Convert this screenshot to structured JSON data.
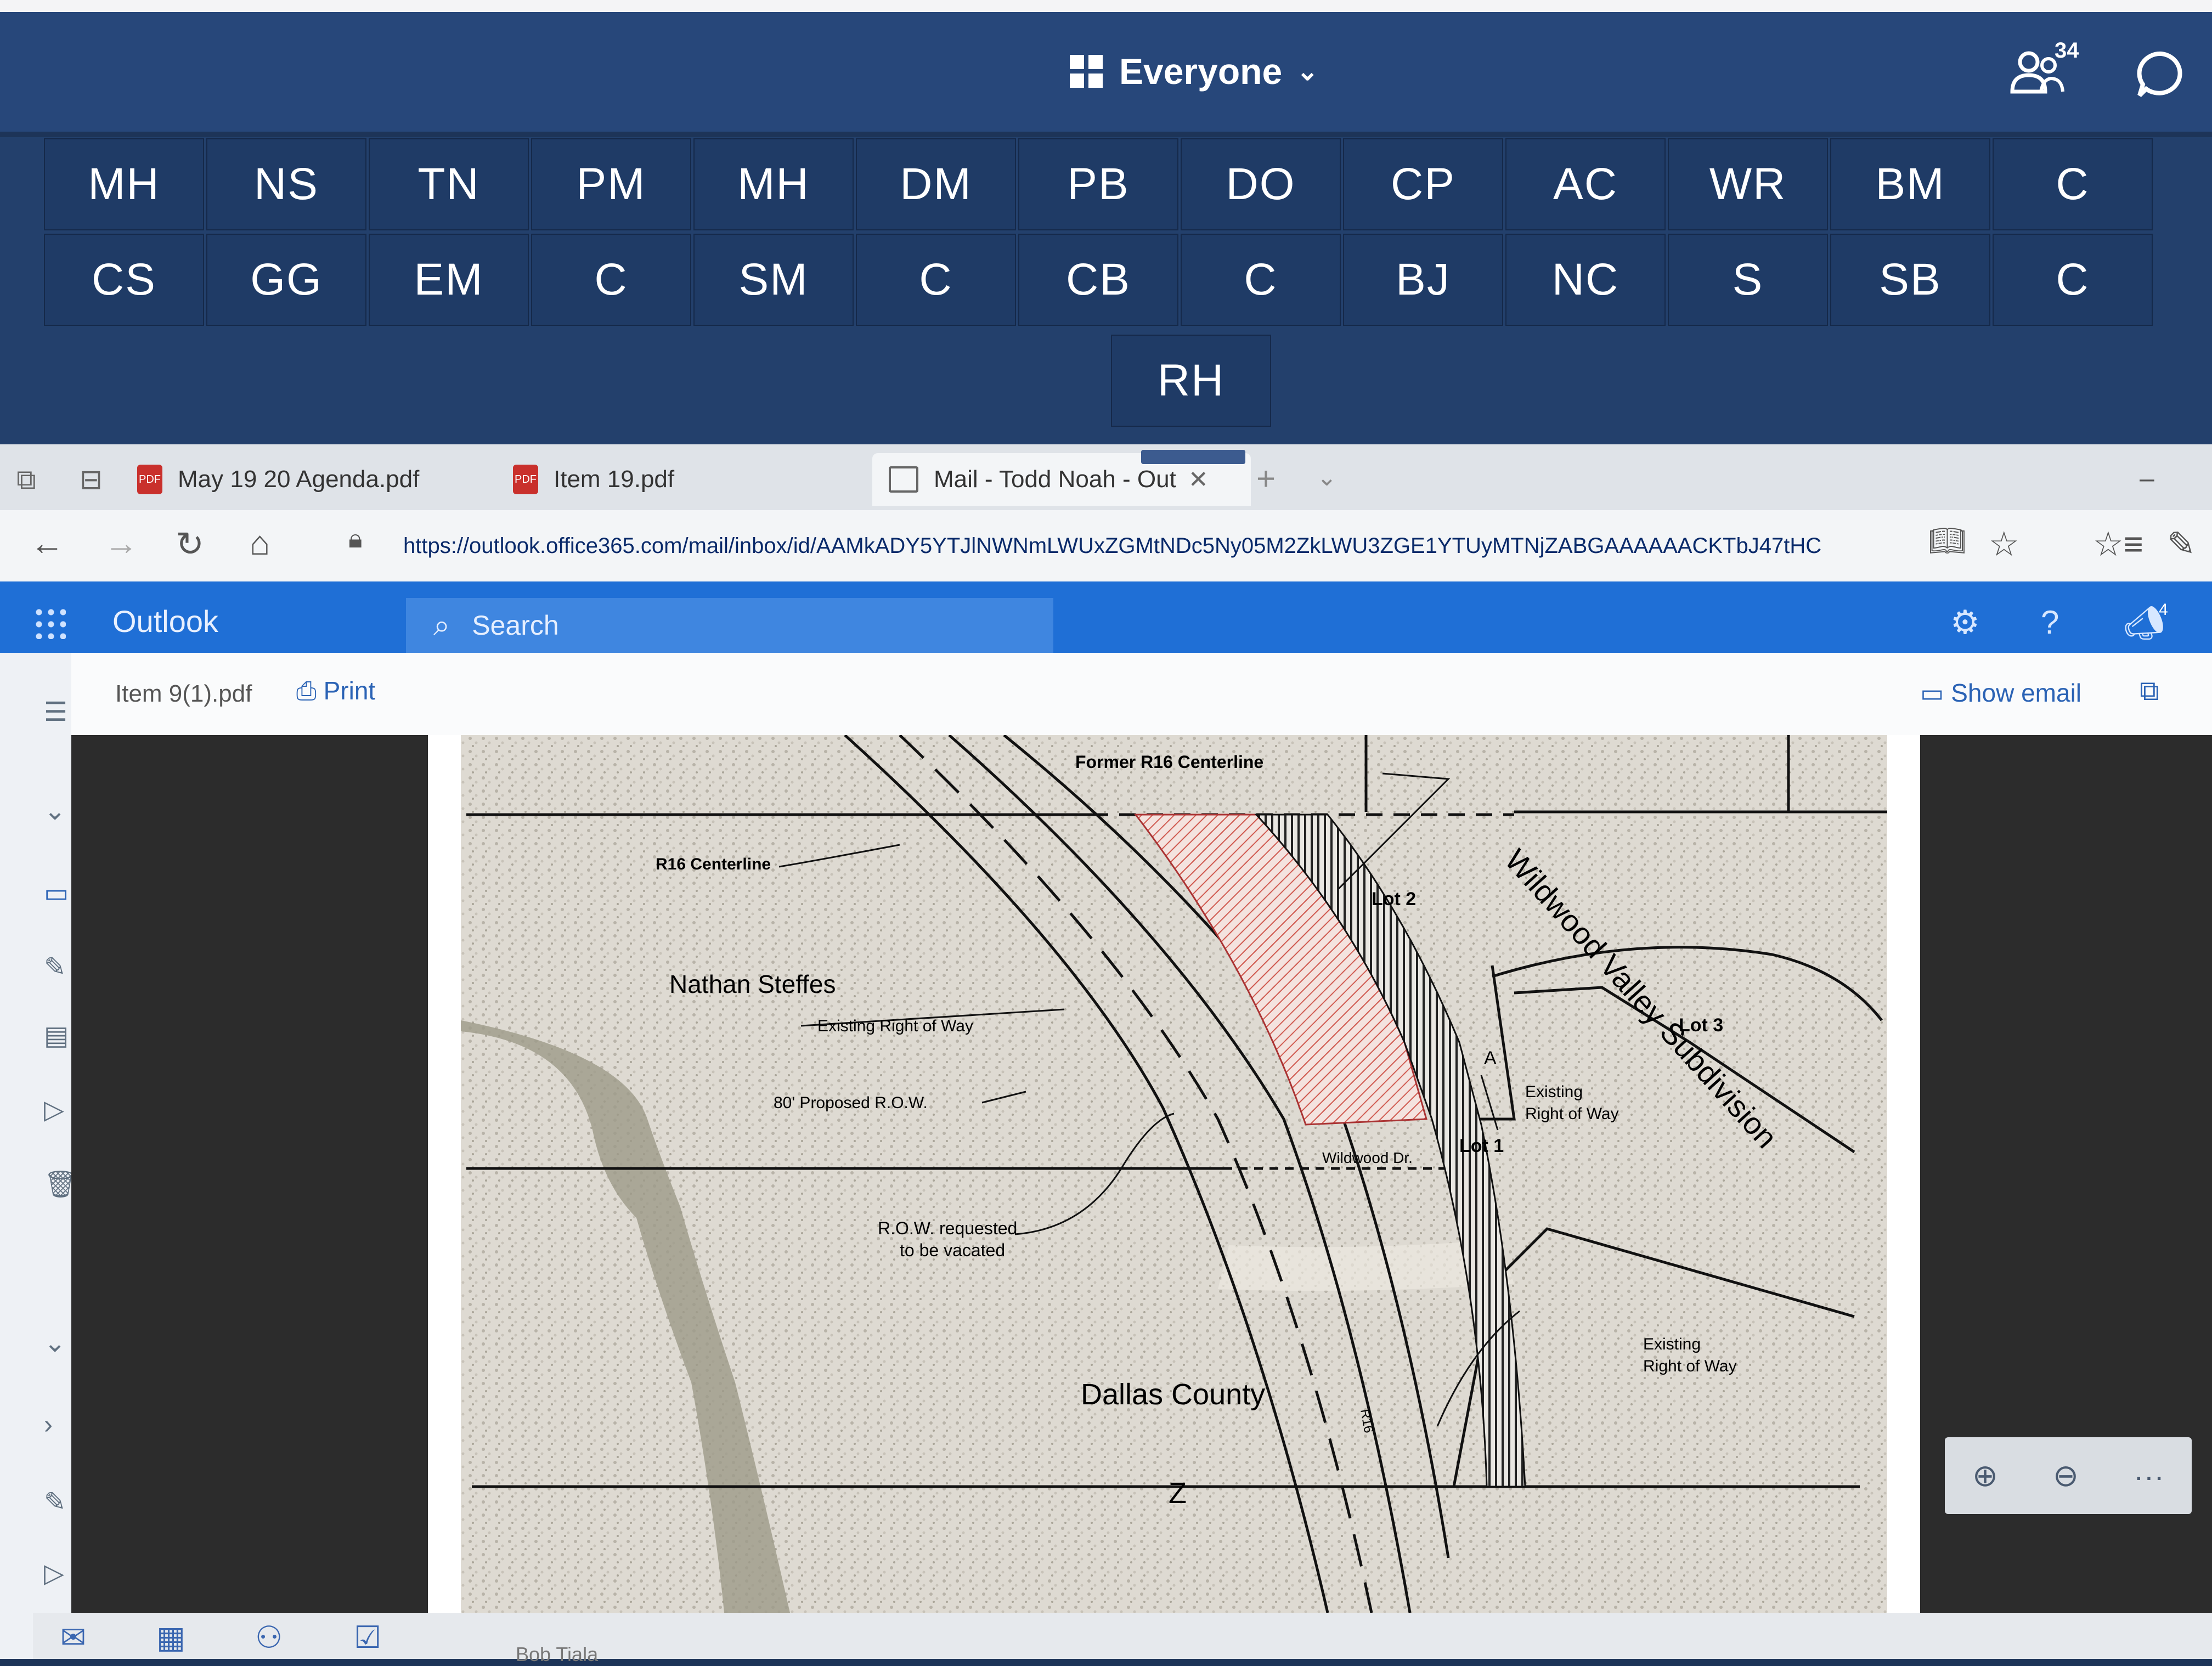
{
  "meeting": {
    "view_label": "Everyone",
    "participant_count": "34",
    "tiles": [
      [
        "MH",
        "NS",
        "TN",
        "PM",
        "MH",
        "DM",
        "PB",
        "DO",
        "CP",
        "AC",
        "WR",
        "BM",
        "C"
      ],
      [
        "CS",
        "GG",
        "EM",
        "C",
        "SM",
        "C",
        "CB",
        "C",
        "BJ",
        "NC",
        "S",
        "SB",
        "C"
      ],
      [
        "RH"
      ]
    ]
  },
  "browser": {
    "tabs": [
      {
        "label": "May 19 20 Agenda.pdf",
        "icon": "pdf-icon"
      },
      {
        "label": "Item 19.pdf",
        "icon": "pdf-icon"
      },
      {
        "label": "Mail - Todd Noah - Out",
        "icon": "mail-icon"
      }
    ],
    "url": "https://outlook.office365.com/mail/inbox/id/AAMkADY5YTJlNWNmLWUxZGMtNDc5Ny05M2ZkLWU3ZGE1YTUyMTNjZABGAAAAAACKTbJ47tHC"
  },
  "outlook": {
    "app_name": "Outlook",
    "search_placeholder": "Search",
    "notification_badge": "4",
    "attachment_name": "Item 9(1).pdf",
    "print_label": "Print",
    "show_email_label": "Show email"
  },
  "map": {
    "labels": {
      "former_centerline": "Former R16 Centerline",
      "r16_centerline": "R16 Centerline",
      "lot2": "Lot 2",
      "lot3": "Lot 3",
      "lot1": "Lot 1",
      "subdivision": "Wildwood Valley Subdivision",
      "owner": "Nathan Steffes",
      "existing_row": "Existing Right of Way",
      "existing_row2a": "Existing",
      "existing_row2b": "Right of Way",
      "existing_row3a": "Existing",
      "existing_row3b": "Right of Way",
      "proposed_row": "80' Proposed R.O.W.",
      "wildwood_dr": "Wildwood Dr.",
      "row_vacated_a": "R.O.W. requested",
      "row_vacated_b": "to be vacated",
      "county": "Dallas County",
      "road_tag": "R16",
      "parcel_a": "A"
    }
  },
  "taskbar": {
    "user_name": "Bob Tiala"
  }
}
